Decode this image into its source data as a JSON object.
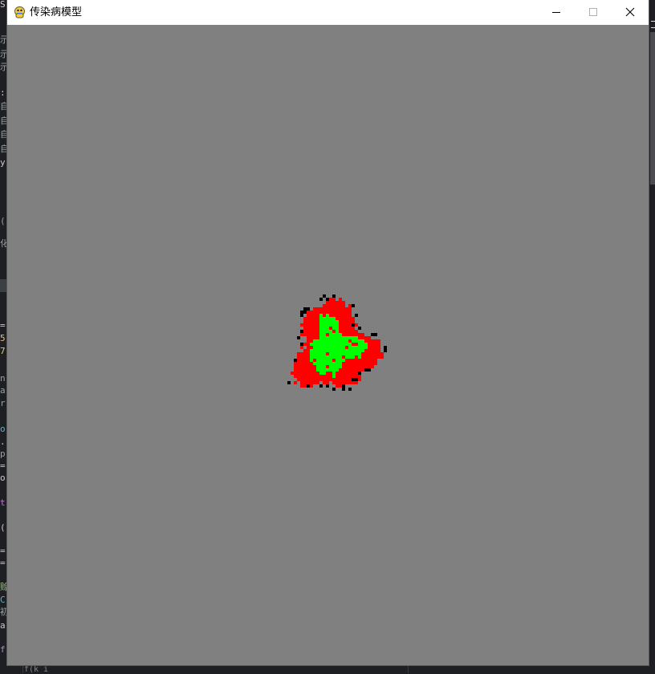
{
  "window": {
    "title": "传染病模型",
    "app_icon": "pygame-snake-icon",
    "controls": [
      "minimize-icon",
      "maximize-icon",
      "close-icon"
    ]
  },
  "simulation": {
    "background_color": "#808080",
    "colors": {
      "infected": "#ff0000",
      "recovered": "#00ff00",
      "dead": "#000000"
    }
  },
  "background_editor": {
    "left_glyphs": [
      {
        "text": "S",
        "color": "#cccccc"
      },
      {
        "text": "示",
        "color": "#9aa0a6"
      },
      {
        "text": "示",
        "color": "#9aa0a6"
      },
      {
        "text": "示",
        "color": "#9aa0a6"
      },
      {
        "text": ":",
        "color": "#cccccc"
      },
      {
        "text": "自",
        "color": "#9aa0a6"
      },
      {
        "text": "自",
        "color": "#9aa0a6"
      },
      {
        "text": "自",
        "color": "#9aa0a6"
      },
      {
        "text": "自",
        "color": "#9aa0a6"
      },
      {
        "text": "y",
        "color": "#cccccc"
      },
      {
        "text": "(",
        "color": "#9aa0a6"
      },
      {
        "text": "化",
        "color": "#9aa0a6"
      },
      {
        "text": "=",
        "color": "#cccccc"
      },
      {
        "text": "5",
        "color": "#e5c07b"
      },
      {
        "text": "7",
        "color": "#e5c07b"
      },
      {
        "text": "n",
        "color": "#9aa0a6"
      },
      {
        "text": "a",
        "color": "#9aa0a6"
      },
      {
        "text": "r",
        "color": "#9aa0a6"
      },
      {
        "text": "o",
        "color": "#56b6c2"
      },
      {
        "text": ".",
        "color": "#cccccc"
      },
      {
        "text": "p",
        "color": "#9aa0a6"
      },
      {
        "text": "=",
        "color": "#cccccc"
      },
      {
        "text": "o",
        "color": "#cccccc"
      },
      {
        "text": "t",
        "color": "#c678dd"
      },
      {
        "text": "(",
        "color": "#cccccc"
      },
      {
        "text": "=",
        "color": "#cccccc"
      },
      {
        "text": "=",
        "color": "#cccccc"
      },
      {
        "text": "赊",
        "color": "#98c379"
      },
      {
        "text": "C",
        "color": "#56b6c2"
      },
      {
        "text": "初",
        "color": "#9aa0a6"
      },
      {
        "text": "a",
        "color": "#cccccc"
      },
      {
        "text": "f",
        "color": "#c678dd"
      }
    ],
    "bottom_text": "f(k  i"
  }
}
